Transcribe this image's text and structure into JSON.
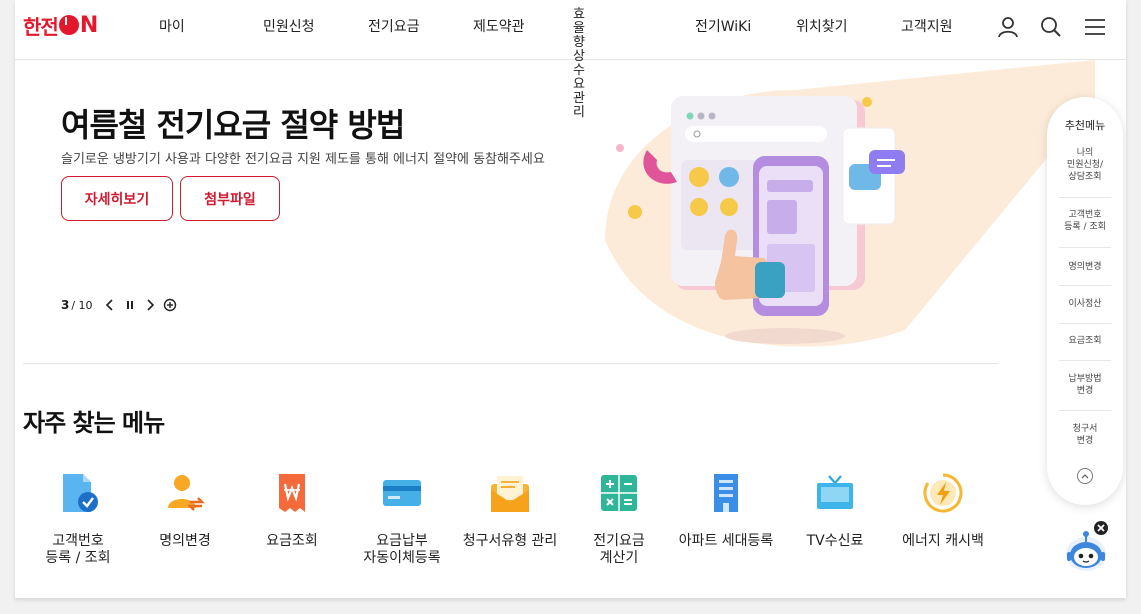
{
  "header": {
    "logo_text": "한전",
    "logo_on": "N",
    "nav": [
      "마이",
      "민원신청",
      "전기요금",
      "제도약관",
      "효율향상\n수요관리",
      "전기WiKi",
      "위치찾기",
      "고객지원"
    ]
  },
  "hero": {
    "title": "여름철 전기요금 절약 방법",
    "subtitle": "슬기로운 냉방기기 사용과 다양한 전기요금 지원 제도를 통해 에너지 절약에 동참해주세요",
    "detail_button": "자세히보기",
    "attach_button": "첨부파일",
    "slide_current": "3",
    "slide_total": "/ 10"
  },
  "frequent": {
    "title": "자주 찾는 메뉴",
    "items": [
      {
        "label": "고객번호\n등록 / 조회",
        "icon": "document-check-icon"
      },
      {
        "label": "명의변경",
        "icon": "person-transfer-icon"
      },
      {
        "label": "요금조회",
        "icon": "won-receipt-icon"
      },
      {
        "label": "요금납부\n자동이체등록",
        "icon": "credit-card-icon"
      },
      {
        "label": "청구서유형 관리",
        "icon": "envelope-icon"
      },
      {
        "label": "전기요금\n계산기",
        "icon": "calculator-icon"
      },
      {
        "label": "아파트 세대등록",
        "icon": "apartment-icon"
      },
      {
        "label": "TV수신료",
        "icon": "tv-icon"
      },
      {
        "label": "에너지 캐시백",
        "icon": "energy-cashback-icon"
      }
    ]
  },
  "quick": {
    "title": "추천메뉴",
    "items": [
      "나의\n민원신청/\n상담조회",
      "고객번호\n등록 / 조회",
      "명의변경",
      "이사정산",
      "요금조회",
      "납부방법\n변경",
      "청구서\n변경"
    ]
  },
  "colors": {
    "brand_red": "#d01a2e",
    "hero_bg_peach": "#fdebd9"
  }
}
